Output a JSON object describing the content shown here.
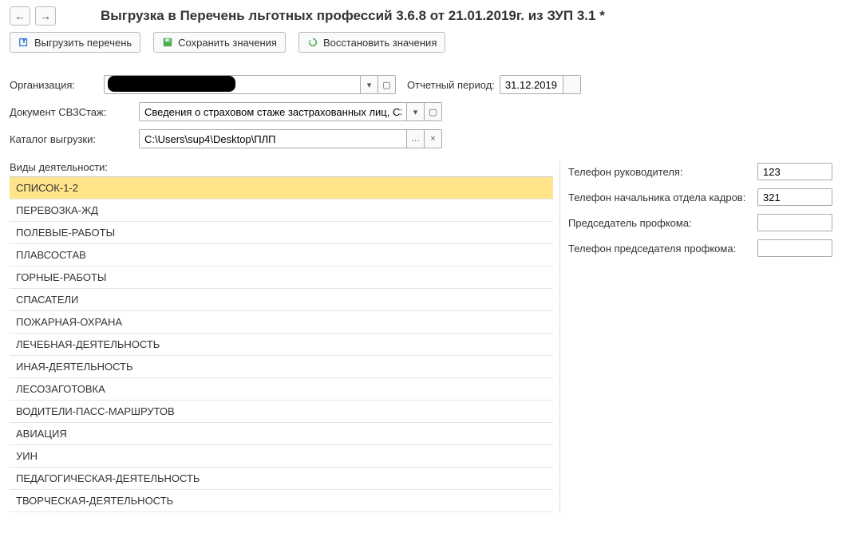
{
  "header": {
    "title": "Выгрузка в Перечень льготных профессий 3.6.8 от 21.01.2019г. из ЗУП 3.1 *"
  },
  "toolbar": {
    "export_label": "Выгрузить перечень",
    "save_label": "Сохранить значения",
    "restore_label": "Восстановить значения"
  },
  "form": {
    "org_label": "Организация:",
    "org_value": "",
    "period_label": "Отчетный период:",
    "period_value": "31.12.2019",
    "doc_label": "Документ СВЗСтаж:",
    "doc_value": "Сведения о страховом стаже застрахованных лиц, СЗВ-СТ",
    "catalog_label": "Каталог выгрузки:",
    "catalog_value": "C:\\Users\\sup4\\Desktop\\ПЛП"
  },
  "activities": {
    "header": "Виды деятельности:",
    "items": [
      "СПИСОК-1-2",
      "ПЕРЕВОЗКА-ЖД",
      "ПОЛЕВЫЕ-РАБОТЫ",
      "ПЛАВСОСТАВ",
      "ГОРНЫЕ-РАБОТЫ",
      "СПАСАТЕЛИ",
      "ПОЖАРНАЯ-ОХРАНА",
      "ЛЕЧЕБНАЯ-ДЕЯТЕЛЬНОСТЬ",
      "ИНАЯ-ДЕЯТЕЛЬНОСТЬ",
      "ЛЕСОЗАГОТОВКА",
      "ВОДИТЕЛИ-ПАСС-МАРШРУТОВ",
      "АВИАЦИЯ",
      "УИН",
      "ПЕДАГОГИЧЕСКАЯ-ДЕЯТЕЛЬНОСТЬ",
      "ТВОРЧЕСКАЯ-ДЕЯТЕЛЬНОСТЬ"
    ],
    "selected_index": 0
  },
  "side": {
    "tel_head_label": "Телефон руководителя:",
    "tel_head_value": "123",
    "tel_hr_label": "Телефон начальника отдела кадров:",
    "tel_hr_value": "321",
    "chairman_label": "Председатель профкома:",
    "chairman_value": "",
    "tel_chairman_label": "Телефон председателя профкома:",
    "tel_chairman_value": ""
  }
}
